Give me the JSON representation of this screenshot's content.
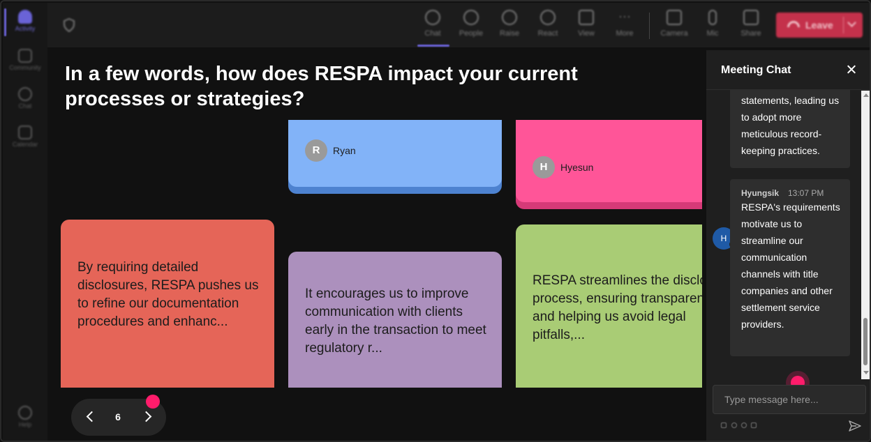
{
  "rail": {
    "items": [
      {
        "label": "Activity",
        "icon": "bell-icon"
      },
      {
        "label": "Community",
        "icon": "community-icon"
      },
      {
        "label": "Chat",
        "icon": "chat-icon"
      },
      {
        "label": "Calendar",
        "icon": "calendar-icon"
      },
      {
        "label": "Help",
        "icon": "help-icon"
      }
    ]
  },
  "toolbar": {
    "buttons": [
      {
        "label": "Chat",
        "icon": "chat-icon"
      },
      {
        "label": "People",
        "icon": "people-icon"
      },
      {
        "label": "Raise",
        "icon": "hand-icon"
      },
      {
        "label": "React",
        "icon": "smiley-icon"
      },
      {
        "label": "View",
        "icon": "grid-icon"
      },
      {
        "label": "More",
        "icon": "more-icon"
      },
      {
        "label": "Camera",
        "icon": "camera-icon"
      },
      {
        "label": "Mic",
        "icon": "mic-icon"
      },
      {
        "label": "Share",
        "icon": "share-icon"
      }
    ],
    "leave_label": "Leave",
    "leave_color": "#c4314b",
    "accent": "#6a63d6"
  },
  "board": {
    "question": "In a few words, how does RESPA impact your current processes or strategies?",
    "notes": [
      {
        "author_initial": "R",
        "author": "Ryan",
        "color": "#82b3f8"
      },
      {
        "author_initial": "H",
        "author": "Hyesun",
        "color": "#ff5598"
      },
      {
        "text": "By requiring detailed disclosures, RESPA pushes us to refine our documentation procedures and enhanc...",
        "color": "#e56558"
      },
      {
        "text": "It encourages us to improve communication with clients early in the transaction to meet regulatory r...",
        "color": "#ac90bd"
      },
      {
        "text": "RESPA streamlines the disclosure process, ensuring transparency and helping us avoid legal pitfalls,...",
        "color": "#a9cc75"
      }
    ],
    "page": "6"
  },
  "chat": {
    "title": "Meeting Chat",
    "messages": [
      {
        "text": "statements, leading us to adopt more meticulous record-keeping practices."
      },
      {
        "initial": "H",
        "sender": "Hyungsik",
        "time": "13:07 PM",
        "text": "RESPA's requirements motivate us to streamline our communication channels with title companies and other settlement service providers."
      }
    ],
    "input_placeholder": "Type message here...",
    "highlight_color": "#ff1c6b"
  }
}
